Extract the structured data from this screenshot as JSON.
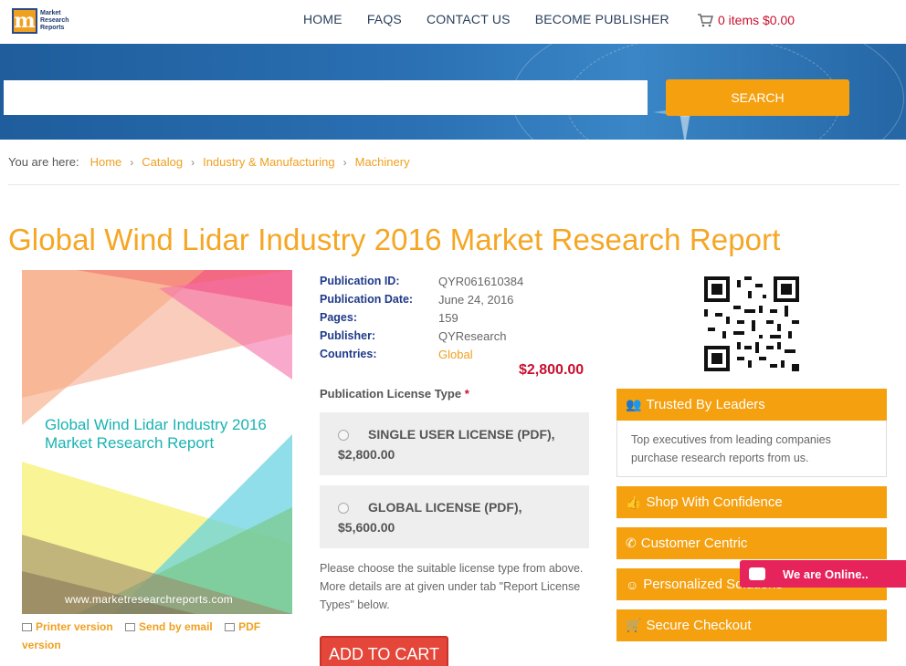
{
  "header": {
    "logo_text": "Market Research Reports",
    "logo_letter": "m",
    "nav": [
      "HOME",
      "FAQS",
      "CONTACT US",
      "BECOME PUBLISHER"
    ],
    "cart_text": "0 items $0.00"
  },
  "search": {
    "placeholder": "",
    "button_label": "SEARCH"
  },
  "breadcrumb": {
    "label": "You are here:",
    "items": [
      "Home",
      "Catalog",
      "Industry & Manufacturing",
      "Machinery"
    ]
  },
  "page_title": "Global Wind Lidar Industry 2016 Market Research Report",
  "cover": {
    "title": "Global Wind Lidar Industry 2016 Market Research Report",
    "url": "www.marketresearchreports.com"
  },
  "doc_links": {
    "printer": "Printer version",
    "email": "Send by email",
    "pdf": "PDF",
    "pdf_suffix": "version"
  },
  "meta": {
    "rows": [
      {
        "key": "Publication ID:",
        "value": "QYR061610384"
      },
      {
        "key": "Publication Date:",
        "value": "June 24, 2016"
      },
      {
        "key": "Pages:",
        "value": "159"
      },
      {
        "key": "Publisher:",
        "value": "QYResearch"
      },
      {
        "key": "Countries:",
        "value": "Global"
      }
    ],
    "price": "$2,800.00"
  },
  "license": {
    "heading": "Publication License Type",
    "required_mark": "*",
    "options": [
      {
        "name": "SINGLE USER LICENSE (PDF),",
        "price": "$2,800.00"
      },
      {
        "name": "GLOBAL LICENSE (PDF),",
        "price": "$5,600.00"
      }
    ],
    "note": "Please choose the suitable license type from above. More details are at given under tab \"Report License Types\" below.",
    "add_to_cart": "ADD TO CART"
  },
  "sidebar": {
    "trusted_title": "Trusted By Leaders",
    "trusted_body": "Top executives from leading companies purchase research reports from us.",
    "boxes": [
      "Shop With Confidence",
      "Customer Centric",
      "Personalized Solutions",
      "Secure Checkout"
    ]
  },
  "chat": {
    "label": "We are Online.."
  },
  "colors": {
    "accent": "#f5a00f",
    "price": "#c8102e",
    "label_blue": "#1f3a8a",
    "cart_button": "#e4463a",
    "chat": "#e6235a"
  }
}
